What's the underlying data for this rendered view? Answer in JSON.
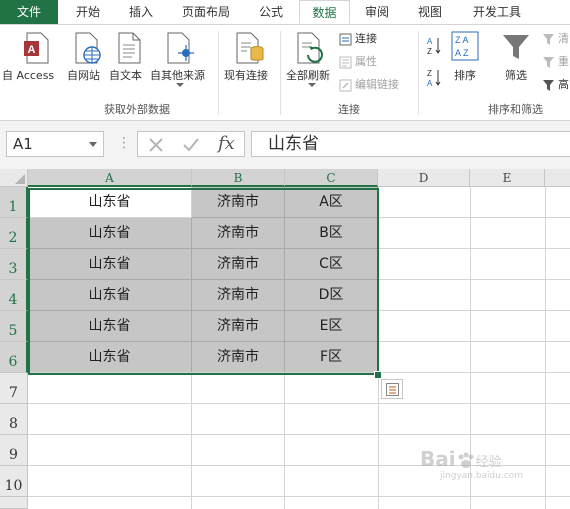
{
  "tabs": [
    {
      "label": "文件"
    },
    {
      "label": "开始"
    },
    {
      "label": "插入"
    },
    {
      "label": "页面布局"
    },
    {
      "label": "公式"
    },
    {
      "label": "数据"
    },
    {
      "label": "审阅"
    },
    {
      "label": "视图"
    },
    {
      "label": "开发工具"
    }
  ],
  "ribbon": {
    "get_external": {
      "access": "自 Access",
      "web": "自网站",
      "text": "自文本",
      "other": "自其他来源",
      "label": "获取外部数据"
    },
    "existing": "现有连接",
    "refresh_all": "全部刷新",
    "connections": {
      "conn": "连接",
      "props": "属性",
      "edit_links": "编辑链接",
      "label": "连接"
    },
    "sort_filter": {
      "sort": "排序",
      "filter": "筛选",
      "clear": "清",
      "reapply": "重",
      "advanced": "高",
      "label": "排序和筛选"
    }
  },
  "formula_bar": {
    "name_box": "A1",
    "fx": "fx",
    "content": "山东省"
  },
  "columns": [
    "A",
    "B",
    "C",
    "D",
    "E"
  ],
  "rows": [
    "1",
    "2",
    "3",
    "4",
    "5",
    "6",
    "7",
    "8",
    "9",
    "10"
  ],
  "cells": [
    [
      "山东省",
      "济南市",
      "A区"
    ],
    [
      "山东省",
      "济南市",
      "B区"
    ],
    [
      "山东省",
      "济南市",
      "C区"
    ],
    [
      "山东省",
      "济南市",
      "D区"
    ],
    [
      "山东省",
      "济南市",
      "E区"
    ],
    [
      "山东省",
      "济南市",
      "F区"
    ]
  ],
  "watermark": {
    "brand": "Bai",
    "sub": "经验",
    "domain": "jingyan.baidu.com"
  },
  "colors": {
    "accent": "#217346",
    "selected_fill": "#c6c6c6"
  }
}
